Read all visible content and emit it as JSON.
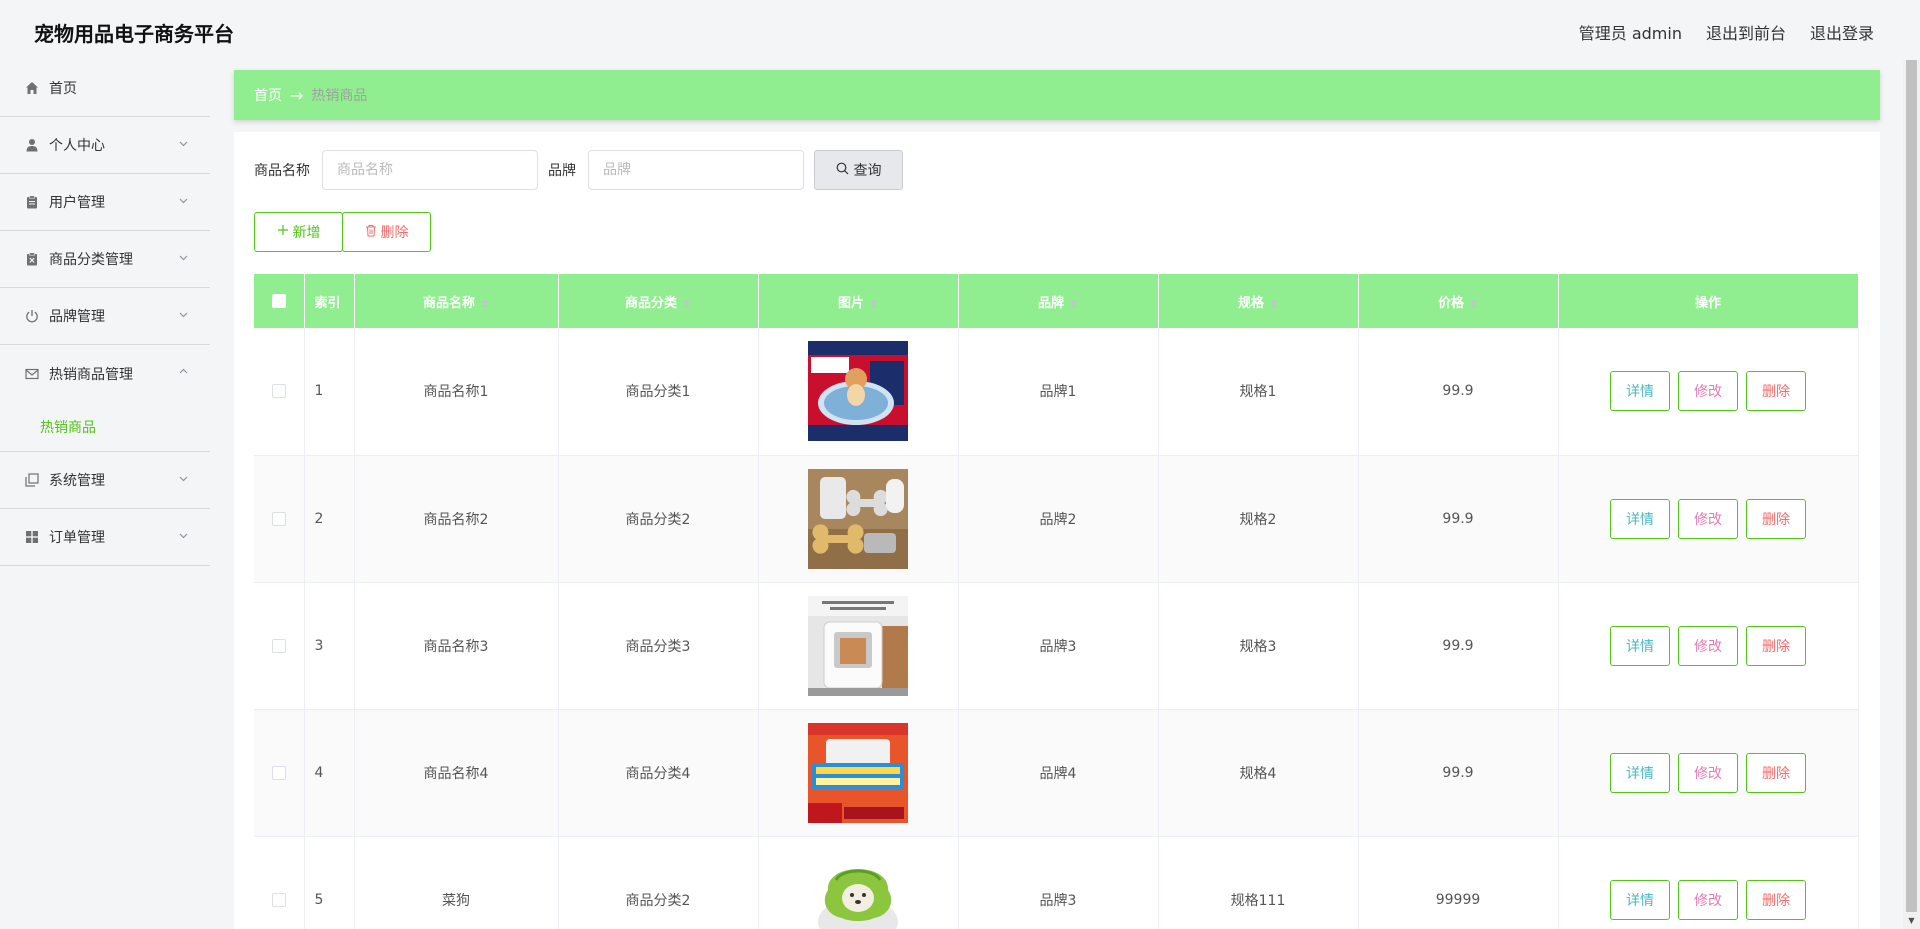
{
  "header": {
    "title": "宠物用品电子商务平台",
    "admin": "管理员 admin",
    "to_front": "退出到前台",
    "logout": "退出登录"
  },
  "sidebar": {
    "items": [
      {
        "label": "首页",
        "icon": "home-icon"
      },
      {
        "label": "个人中心",
        "icon": "user-icon"
      },
      {
        "label": "用户管理",
        "icon": "clipboard-icon"
      },
      {
        "label": "商品分类管理",
        "icon": "clipboard-x-icon"
      },
      {
        "label": "品牌管理",
        "icon": "power-icon"
      },
      {
        "label": "热销商品管理",
        "icon": "mail-icon"
      },
      {
        "label": "系统管理",
        "icon": "copy-icon"
      },
      {
        "label": "订单管理",
        "icon": "grid-icon"
      }
    ],
    "submenu": {
      "label": "热销商品"
    }
  },
  "breadcrumb": {
    "home": "首页",
    "arrow": "→",
    "current": "热销商品"
  },
  "search": {
    "name_label": "商品名称",
    "name_placeholder": "商品名称",
    "brand_label": "品牌",
    "brand_placeholder": "品牌",
    "query_label": "查询"
  },
  "actions": {
    "add_label": "新增",
    "delete_label": "删除"
  },
  "table": {
    "headers": {
      "index": "索引",
      "name": "商品名称",
      "category": "商品分类",
      "image": "图片",
      "brand": "品牌",
      "spec": "规格",
      "price": "价格",
      "ops": "操作"
    },
    "row_buttons": {
      "detail": "详情",
      "edit": "修改",
      "delete": "删除"
    },
    "rows": [
      {
        "index": "1",
        "name": "商品名称1",
        "category": "商品分类1",
        "image": "pet-toilet-product-image",
        "brand": "品牌1",
        "spec": "规格1",
        "price": "99.9"
      },
      {
        "index": "2",
        "name": "商品名称2",
        "category": "商品分类2",
        "image": "pet-tags-product-image",
        "brand": "品牌2",
        "spec": "规格2",
        "price": "99.9"
      },
      {
        "index": "3",
        "name": "商品名称3",
        "category": "商品分类3",
        "image": "pet-dryer-box-product-image",
        "brand": "品牌3",
        "spec": "规格3",
        "price": "99.9"
      },
      {
        "index": "4",
        "name": "商品名称4",
        "category": "商品分类4",
        "image": "pet-dryer-promo-product-image",
        "brand": "品牌4",
        "spec": "规格4",
        "price": "99.9"
      },
      {
        "index": "5",
        "name": "菜狗",
        "category": "商品分类2",
        "image": "cabbage-dog-product-image",
        "brand": "品牌3",
        "spec": "规格111",
        "price": "99999"
      }
    ]
  },
  "colors": {
    "accent_green": "#90ee90",
    "border_green": "#52c41a",
    "danger": "#f56c6c"
  }
}
